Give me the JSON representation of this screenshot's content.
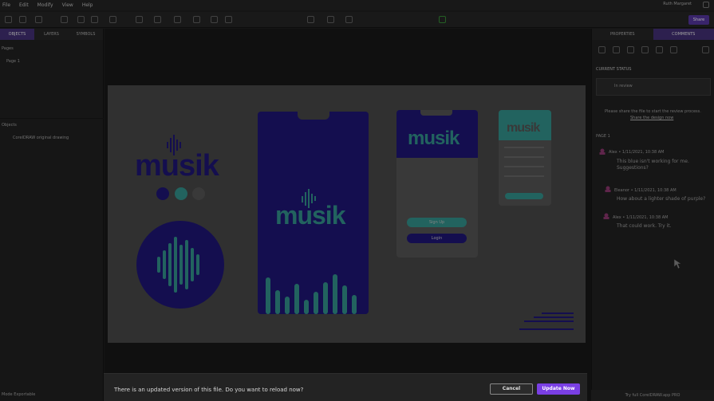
{
  "menu": [
    "File",
    "Edit",
    "Modify",
    "View",
    "Help"
  ],
  "user_label": "Ruth Margaret",
  "share_label": "Share",
  "left_panel": {
    "tabs": [
      "OBJECTS",
      "LAYERS",
      "SYMBOLS"
    ],
    "pages_label": "Pages",
    "page_item": "Page 1",
    "objects_label": "Objects",
    "object_item": "CorelDRAW original drawing",
    "bottom_label": "Mode Exportable"
  },
  "right_panel": {
    "tabs": [
      "PROPERTIES",
      "COMMENTS"
    ],
    "section_title": "CURRENT STATUS",
    "status_value": "In review",
    "review_note": "Please share the file to start the review process.",
    "share_link": "Share the design now",
    "page_label": "PAGE 1",
    "comments": [
      {
        "author": "Alex",
        "time": "1/11/2021, 10:38 AM",
        "text": "This blue isn't working for me. Suggestions?"
      },
      {
        "author": "Eleanor",
        "time": "1/11/2021, 10:38 AM",
        "text": "How about a lighter shade of purple?"
      },
      {
        "author": "Alex",
        "time": "1/11/2021, 10:38 AM",
        "text": "That could work. Try it."
      }
    ],
    "bottom_label": "Try full CorelDRAW.app PRO"
  },
  "artboard": {
    "brand_word": "musik",
    "login_label": "Login",
    "signup_label": "Sign Up"
  },
  "update_bar": {
    "message": "There is an updated version of this file. Do you want to reload now?",
    "cancel_label": "Cancel",
    "update_label": "Update Now"
  },
  "colors": {
    "brand_navy": "#1a1366",
    "brand_teal": "#2c7f7a",
    "accent_purple": "#7a3fe4"
  }
}
